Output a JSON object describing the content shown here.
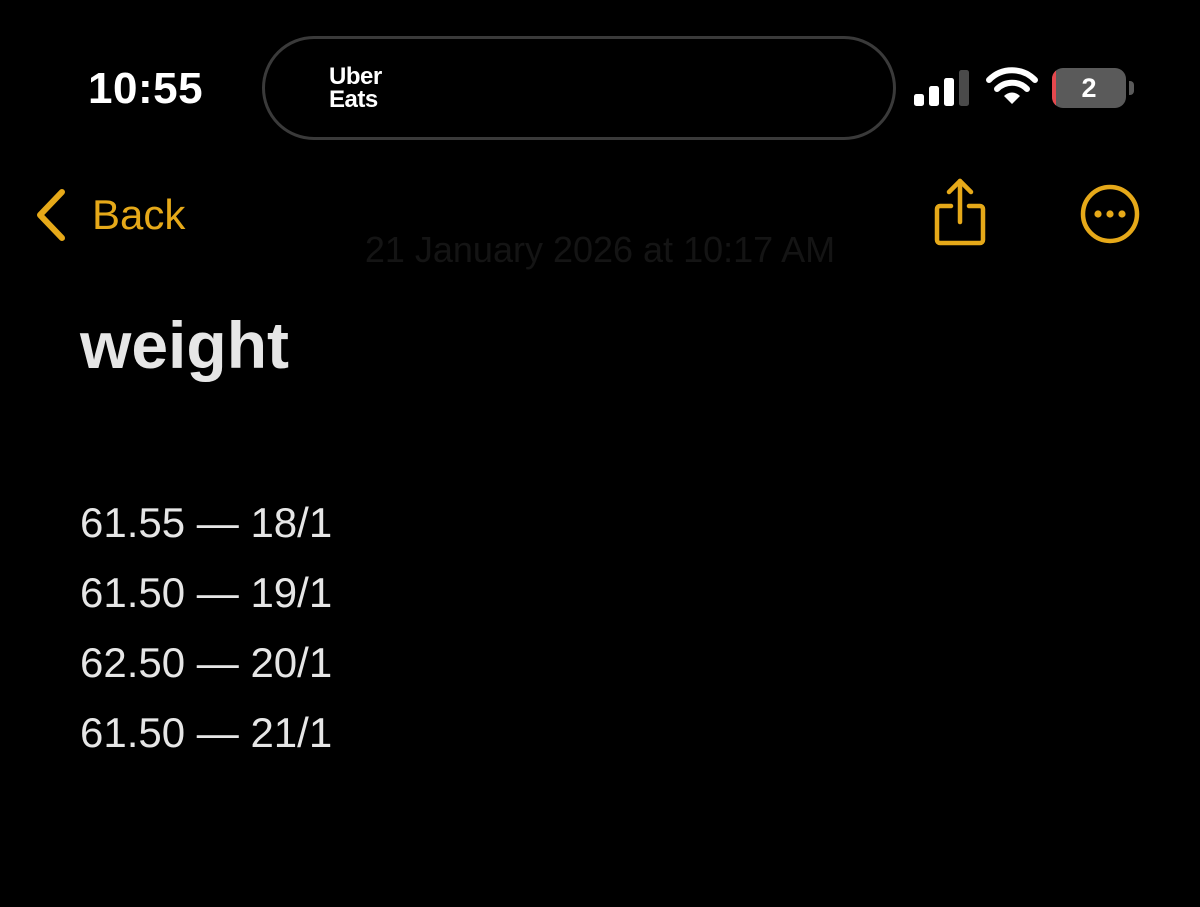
{
  "status_bar": {
    "time": "10:55",
    "live_activity": {
      "app_name_line1": "Uber",
      "app_name_line2": "Eats"
    },
    "signal_icon": "cellular-signal-icon",
    "wifi_icon": "wifi-icon",
    "battery": {
      "level": "2",
      "level_fraction": 0.02,
      "low_color": "#e5484d"
    }
  },
  "nav": {
    "back_label": "Back",
    "back_icon": "chevron-left-icon",
    "share_icon": "share-icon",
    "more_icon": "ellipsis-circle-icon",
    "accent_color": "#e6a919"
  },
  "note": {
    "date": "21 January 2026 at 10:17 AM",
    "title": "weight",
    "entries": [
      "61.55 — 18/1",
      "61.50 — 19/1",
      "62.50 — 20/1",
      "61.50 — 21/1"
    ]
  }
}
